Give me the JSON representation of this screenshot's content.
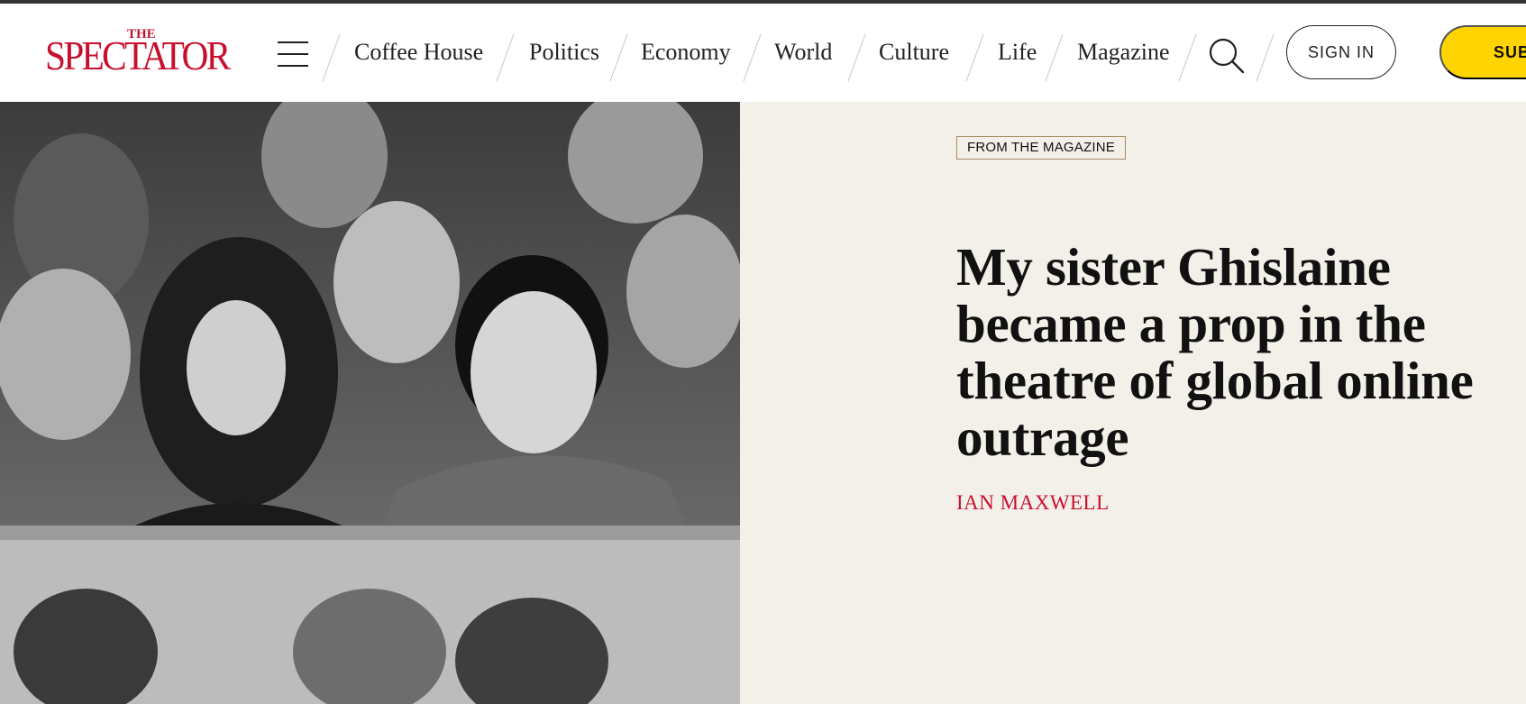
{
  "brand": {
    "logo_small": "THE",
    "logo_word": "SPECTATOR",
    "logo_color": "#c8102e"
  },
  "nav": {
    "menu_icon": "hamburger-icon",
    "links": [
      "Coffee House",
      "Politics",
      "Economy",
      "World",
      "Culture",
      "Life",
      "Magazine"
    ],
    "search_icon": "search-icon",
    "sign_in_label": "SIGN IN",
    "subscribe_label": "SUB",
    "subscribe_color": "#ffd400"
  },
  "hero": {
    "image_description_icon": "photo",
    "badge": "FROM THE MAGAZINE",
    "headline": "My sister Ghislaine became a prop in the theatre of global online outrage",
    "author": "IAN MAXWELL",
    "panel_color": "#f3f0e9",
    "author_color": "#c8102e"
  }
}
